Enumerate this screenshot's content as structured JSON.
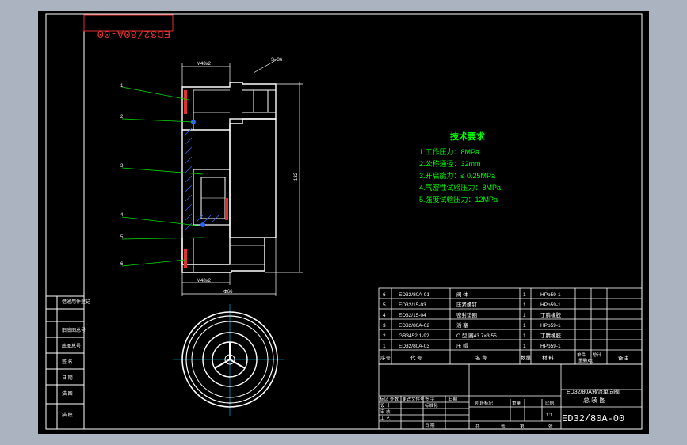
{
  "drawing_number_mirrored": "ED32/80A-00",
  "dimensions": {
    "top_thread": "M48x2",
    "hex": "S=36",
    "bottom_thread": "M48x2",
    "outer_dia": "Φ66",
    "height": "132"
  },
  "leaders": [
    "1",
    "2",
    "3",
    "4",
    "5",
    "6"
  ],
  "tech": {
    "title": "技术要求",
    "items": [
      "1.工作压力：8MPa",
      "2.公称通径：32mm",
      "3.开启能力：≤ 0.25MPa",
      "4.气密性试验压力：8MPa",
      "5.强度试验压力：12MPa"
    ]
  },
  "bom": {
    "rows": [
      {
        "no": "6",
        "code": "ED32/80A-01",
        "name": "阀  体",
        "qty": "1",
        "mat": "HPb59-1"
      },
      {
        "no": "5",
        "code": "ED32/15-03",
        "name": "压紧螺钉",
        "qty": "1",
        "mat": "HPb59-1"
      },
      {
        "no": "4",
        "code": "ED32/15-04",
        "name": "密封垫圈",
        "qty": "1",
        "mat": "丁腈橡胶"
      },
      {
        "no": "3",
        "code": "ED32/80A-02",
        "name": "活  塞",
        "qty": "1",
        "mat": "HPb59-1"
      },
      {
        "no": "2",
        "code": "GB3452.1-92",
        "name": "O 型 圈43.7×3.55",
        "qty": "1",
        "mat": "丁腈橡胶"
      },
      {
        "no": "1",
        "code": "ED32/80A-03",
        "name": "压  帽",
        "qty": "1",
        "mat": "HPb59-1"
      }
    ],
    "header": {
      "no": "序号",
      "code": "代   号",
      "name": "名   称",
      "qty": "数量",
      "mat": "材  料",
      "unit": "单件",
      "total": "总计",
      "weight": "重量(kg)",
      "note": "备注"
    }
  },
  "title_block": {
    "name": "ED32/80A液流单向阀",
    "sub": "总 装 图",
    "code": "ED32/80A-00",
    "scale": "1:1",
    "labels_left": [
      "标记",
      "处数",
      "更改文件号",
      "签 字",
      "日期"
    ],
    "labels_rows": [
      "设 计",
      "标准化",
      "审 核",
      "工 艺",
      "日 期"
    ],
    "stage": "阶段标记",
    "weight": "重量",
    "ratio": "比例",
    "sheets": [
      "共",
      "张",
      "第",
      "张"
    ]
  },
  "side_labels": [
    "借通用件登记",
    "旧底图总号",
    "底图总号",
    "签 名",
    "日 期",
    "描 图",
    "描 校"
  ]
}
